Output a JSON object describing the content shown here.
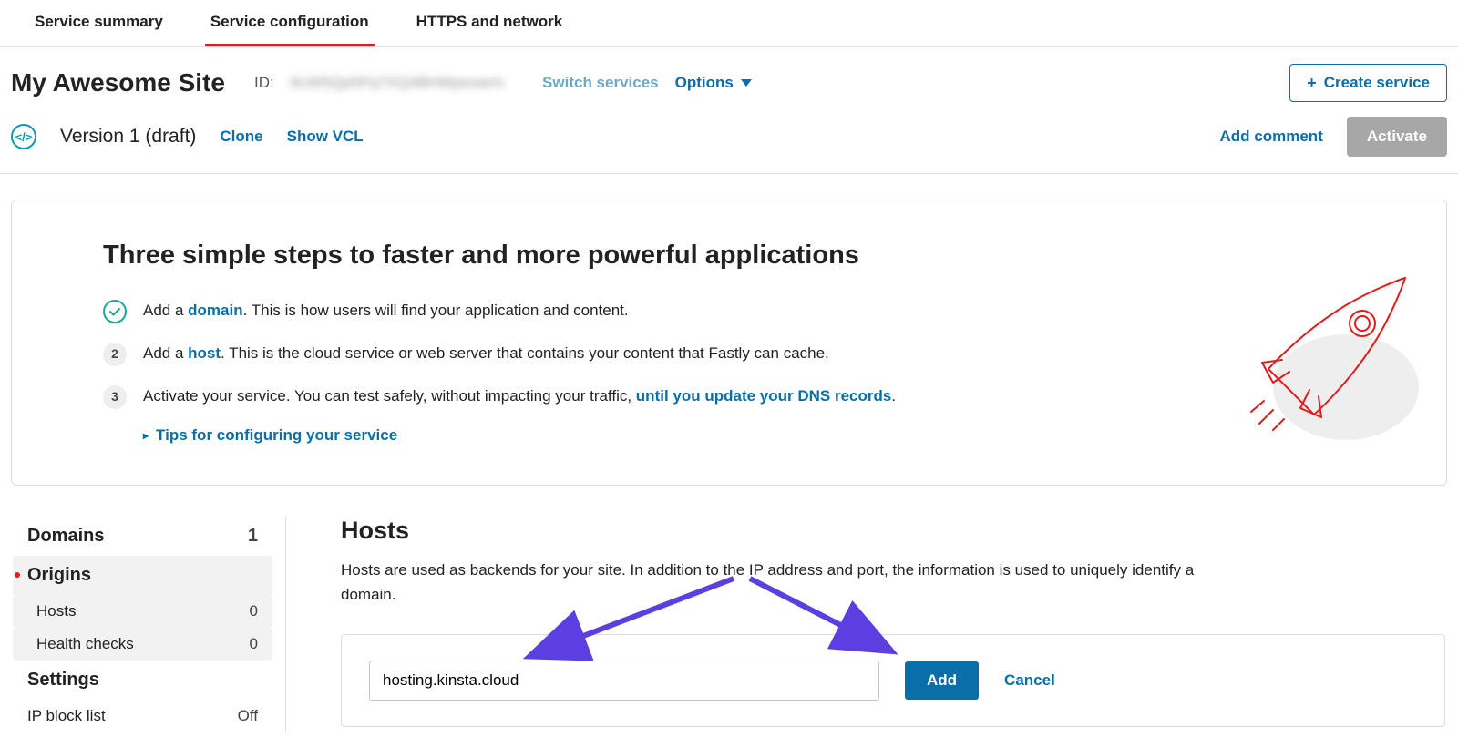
{
  "tabs": {
    "summary": "Service summary",
    "configuration": "Service configuration",
    "https": "HTTPS and network"
  },
  "service": {
    "name": "My Awesome Site",
    "id_label": "ID:",
    "id_value": "6cW5QphPq7XQ4BHMpesarm",
    "switch": "Switch services",
    "options": "Options",
    "create": "Create service"
  },
  "version": {
    "label": "Version 1 (draft)",
    "clone": "Clone",
    "show_vcl": "Show VCL",
    "add_comment": "Add comment",
    "activate": "Activate"
  },
  "onboarding": {
    "heading": "Three simple steps to faster and more powerful applications",
    "step1_pre": "Add a ",
    "step1_link": "domain",
    "step1_post": ". This is how users will find your application and content.",
    "step2_pre": "Add a ",
    "step2_link": "host",
    "step2_post": ". This is the cloud service or web server that contains your content that Fastly can cache.",
    "step3_pre": "Activate your service. You can test safely, without impacting your traffic, ",
    "step3_link": "until you update your DNS records",
    "step3_post": ".",
    "badge2": "2",
    "badge3": "3",
    "tips": "Tips for configuring your service"
  },
  "sidebar": {
    "domains": {
      "label": "Domains",
      "count": "1"
    },
    "origins": {
      "label": "Origins"
    },
    "hosts": {
      "label": "Hosts",
      "count": "0"
    },
    "health": {
      "label": "Health checks",
      "count": "0"
    },
    "settings": {
      "label": "Settings"
    },
    "ipblock": {
      "label": "IP block list",
      "value": "Off"
    }
  },
  "hosts": {
    "title": "Hosts",
    "desc": "Hosts are used as backends for your site. In addition to the IP address and port, the information is used to uniquely identify a domain.",
    "input_value": "hosting.kinsta.cloud",
    "add": "Add",
    "cancel": "Cancel"
  }
}
